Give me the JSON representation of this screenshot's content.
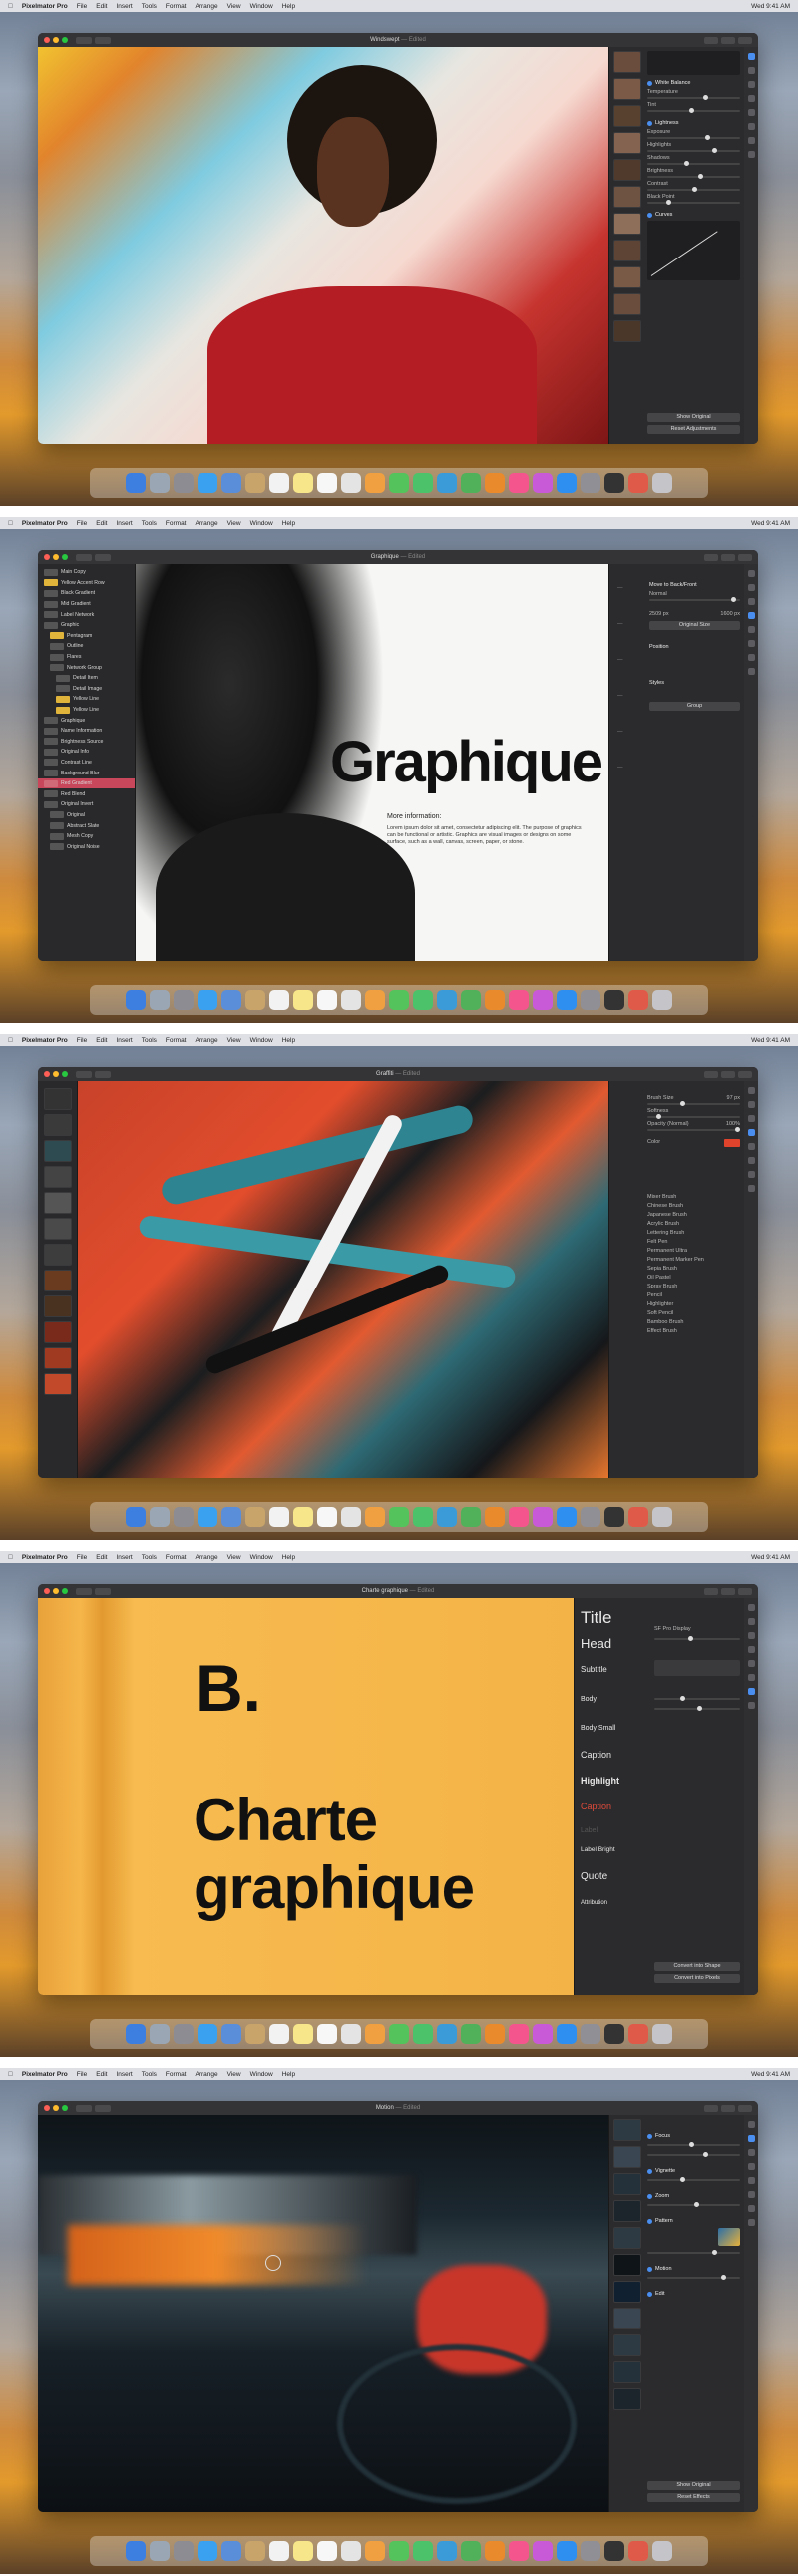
{
  "menubar": {
    "app_name": "Pixelmator Pro",
    "menus": [
      "File",
      "Edit",
      "Insert",
      "Tools",
      "Format",
      "Arrange",
      "View",
      "Window",
      "Help"
    ],
    "clock": "Wed 9:41 AM"
  },
  "screens": [
    {
      "doc_title": "Windswept",
      "doc_suffix": "— Edited",
      "adjustments": [
        {
          "label": "White Balance",
          "rows": [
            "Temperature",
            "Tint"
          ]
        },
        {
          "label": "Lightness",
          "rows": [
            "Exposure",
            "Highlights",
            "Shadows",
            "Brightness",
            "Contrast",
            "Black Point"
          ]
        },
        {
          "label": "Curves",
          "rows": []
        }
      ],
      "buttons": [
        "Show Original",
        "Reset Adjustments"
      ]
    },
    {
      "doc_title": "Graphique",
      "doc_suffix": "— Edited",
      "headline": "Graphique",
      "info_heading": "More information:",
      "info_body": "Lorem ipsum dolor sit amet, consectetur adipiscing elit. The purpose of graphics can be functional or artistic. Graphics are visual images or designs on some surface, such as a wall, canvas, screen, paper, or stone.",
      "layers": [
        "Main Copy",
        "Yellow Accent Row",
        "Black Gradient",
        "Mid Gradient",
        "Label Network",
        "Graphic",
        "Pentagram",
        "Outline",
        "Flares",
        "Network Group",
        "Detail Item",
        "Detail Image",
        "Yellow Line",
        "Yellow Line",
        "Graphique",
        "Name Information",
        "Brightness Source",
        "Original Info",
        "Contrast Line",
        "Background Blur",
        "Red Gradient",
        "Red Blend",
        "Original Invert",
        "Original",
        "Abstract Slate",
        "Mesh Copy",
        "Original Noise"
      ],
      "arrange": {
        "title": "Move to Back/Front",
        "blend": "Normal",
        "size_w": "2509 px",
        "size_h": "1600 px",
        "original_size": "Original Size",
        "position": "Position",
        "style": "Styles",
        "group": "Group"
      }
    },
    {
      "doc_title": "Graffiti",
      "doc_suffix": "— Edited",
      "brush": {
        "size_label": "Brush Size",
        "size_value": "97 px",
        "softness": "Softness",
        "opacity": "Opacity (Normal)",
        "opacity_value": "100%",
        "color_label": "Color"
      },
      "brushes": [
        "Mixer Brush",
        "Chinese Brush",
        "Japanese Brush",
        "Acrylic Brush",
        "Lettering Brush",
        "Felt Pen",
        "Permanent Ultra",
        "Permanent Marker Pen",
        "Sepia Brush",
        "Oil Pastel",
        "Spray Brush",
        "Pencil",
        "Highlighter",
        "Soft Pencil",
        "Bamboo Brush",
        "Effect Brush"
      ]
    },
    {
      "doc_title": "Charte graphique",
      "doc_suffix": "— Edited",
      "poster_letter": "B.",
      "poster_title_1": "Charte",
      "poster_title_2": "graphique",
      "styles": [
        "Title",
        "Head",
        "Subtitle",
        "Body",
        "Body Small",
        "Caption",
        "Highlight",
        "Caption",
        "Label",
        "Label Bright",
        "Quote",
        "Attribution"
      ],
      "font": "SF Pro Display",
      "buttons": [
        "Convert into Shape",
        "Convert into Pixels"
      ]
    },
    {
      "doc_title": "Motion",
      "doc_suffix": "— Edited",
      "effects": [
        "Focus",
        "Blur",
        "Vignette",
        "Zoom",
        "Motion",
        "Pattern",
        "Edit"
      ],
      "buttons": [
        "Show Original",
        "Reset Effects"
      ]
    }
  ]
}
